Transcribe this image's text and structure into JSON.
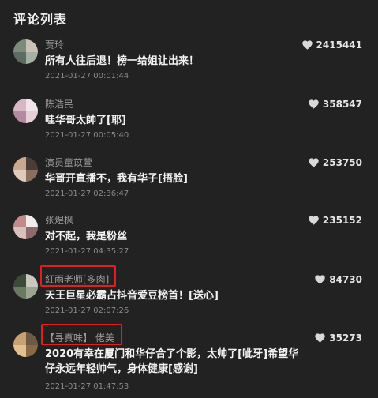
{
  "header": {
    "title": "评论列表"
  },
  "comments": [
    {
      "username": "贾玲",
      "content": "所有人往后退！榜一给姐让出来！",
      "time": "2021-01-27 00:01:44",
      "likes": "2415441",
      "avatar_colors": [
        "#7d8c7a",
        "#c9c2b5",
        "#5e6b62",
        "#a6b0a3"
      ]
    },
    {
      "username": "陈浩民",
      "content": "哇华哥太帥了[耶]",
      "time": "2021-01-27 00:05:40",
      "likes": "358547",
      "avatar_colors": [
        "#d9b6c3",
        "#f0e4ea",
        "#b58aa0",
        "#e7cfd8"
      ]
    },
    {
      "username": "演员童苡萱",
      "content": "华哥开直播不，我有华子[捂脸]",
      "time": "2021-01-27 02:36:47",
      "likes": "253750",
      "avatar_colors": [
        "#c9a98f",
        "#4a3d38",
        "#e0c9b8",
        "#8a6e5e"
      ]
    },
    {
      "username": "张煜枫",
      "content": "对不起，我是粉丝",
      "time": "2021-01-27 04:35:27",
      "likes": "235152",
      "avatar_colors": [
        "#c28a8a",
        "#f2ecec",
        "#d8c1bd",
        "#8f6a6a"
      ]
    },
    {
      "username": "紅雨老师[多肉]",
      "content": "天王巨星必霸占抖音爱豆榜首！[送心]",
      "time": "2021-01-27 02:07:26",
      "likes": "84730",
      "avatar_colors": [
        "#3c4a3a",
        "#c7c9c1",
        "#6a7a60",
        "#9aa48e"
      ]
    },
    {
      "username": "【寻真味】 佬美",
      "content": "2020有幸在厦门和华仔合了个影，太帅了[呲牙]希望华仔永远年轻帅气，身体健康[感谢]",
      "time": "2021-01-27 01:47:53",
      "likes": "35273",
      "avatar_colors": [
        "#c9a070",
        "#6e5a44",
        "#e2c08f",
        "#8a6a42"
      ]
    }
  ],
  "accent_color": "#e02020"
}
